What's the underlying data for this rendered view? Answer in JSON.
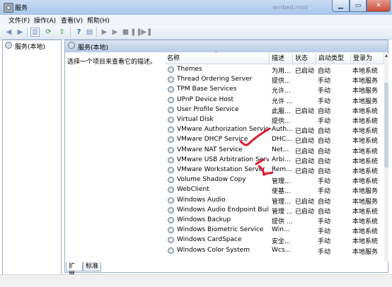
{
  "window": {
    "title": "服务",
    "ghost_text": "wmbed.mod"
  },
  "menu": [
    {
      "label": "文件(F)"
    },
    {
      "label": "操作(A)"
    },
    {
      "label": "查看(V)"
    },
    {
      "label": "帮助(H)"
    }
  ],
  "tree": {
    "label": "服务(本地)"
  },
  "pane": {
    "header": "服务(本地)",
    "description": "选择一个项目来查看它的描述。"
  },
  "table": {
    "columns": [
      "名称",
      "描述",
      "状态",
      "启动类型",
      "登录为"
    ],
    "rows": [
      {
        "name": "Themes",
        "desc": "为用...",
        "state": "已启动",
        "type": "自动",
        "logon": "本地系统"
      },
      {
        "name": "Thread Ordering Server",
        "desc": "提供...",
        "state": "",
        "type": "手动",
        "logon": "本地服务"
      },
      {
        "name": "TPM Base Services",
        "desc": "允许...",
        "state": "",
        "type": "手动",
        "logon": "本地服务"
      },
      {
        "name": "UPnP Device Host",
        "desc": "允许 ...",
        "state": "",
        "type": "手动",
        "logon": "本地服务"
      },
      {
        "name": "User Profile Service",
        "desc": "此服...",
        "state": "已启动",
        "type": "自动",
        "logon": "本地系统"
      },
      {
        "name": "Virtual Disk",
        "desc": "提供...",
        "state": "",
        "type": "手动",
        "logon": "本地系统"
      },
      {
        "name": "VMware Authorization Service",
        "desc": "Auth...",
        "state": "已启动",
        "type": "自动",
        "logon": "本地系统"
      },
      {
        "name": "VMware DHCP Service",
        "desc": "DHC...",
        "state": "已启动",
        "type": "自动",
        "logon": "本地系统"
      },
      {
        "name": "VMware NAT Service",
        "desc": "Net...",
        "state": "已启动",
        "type": "自动",
        "logon": "本地系统"
      },
      {
        "name": "VMware USB Arbitration Service",
        "desc": "Arbi...",
        "state": "已启动",
        "type": "自动",
        "logon": "本地系统"
      },
      {
        "name": "VMware Workstation Server",
        "desc": "Rem...",
        "state": "已启动",
        "type": "自动",
        "logon": "本地系统"
      },
      {
        "name": "Volume Shadow Copy",
        "desc": "管理...",
        "state": "",
        "type": "手动",
        "logon": "本地系统"
      },
      {
        "name": "WebClient",
        "desc": "使基...",
        "state": "",
        "type": "手动",
        "logon": "本地服务"
      },
      {
        "name": "Windows Audio",
        "desc": "管理...",
        "state": "已启动",
        "type": "自动",
        "logon": "本地服务"
      },
      {
        "name": "Windows Audio Endpoint Builder",
        "desc": "管理 ...",
        "state": "已启动",
        "type": "自动",
        "logon": "本地系统"
      },
      {
        "name": "Windows Backup",
        "desc": "提供 ...",
        "state": "",
        "type": "手动",
        "logon": "本地系统"
      },
      {
        "name": "Windows Biometric Service",
        "desc": "Win...",
        "state": "",
        "type": "手动",
        "logon": "本地系统"
      },
      {
        "name": "Windows CardSpace",
        "desc": "安全...",
        "state": "",
        "type": "手动",
        "logon": "本地系统"
      },
      {
        "name": "Windows Color System",
        "desc": "Wcs...",
        "state": "",
        "type": "手动",
        "logon": "本地服务"
      }
    ]
  },
  "tabs": [
    {
      "label": "扩展"
    },
    {
      "label": "标准"
    }
  ],
  "icons": {
    "back": "back-arrow-icon",
    "forward": "forward-arrow-icon",
    "console_tree": "console-tree-icon",
    "refresh": "refresh-icon",
    "export": "export-list-icon",
    "help": "help-icon",
    "properties": "properties-icon",
    "play": "play-icon",
    "play2": "play-icon",
    "stop": "stop-icon",
    "pause": "pause-icon",
    "restart": "restart-icon"
  },
  "colors": {
    "accent": "#b9cde6",
    "handmark": "#e0142c"
  }
}
